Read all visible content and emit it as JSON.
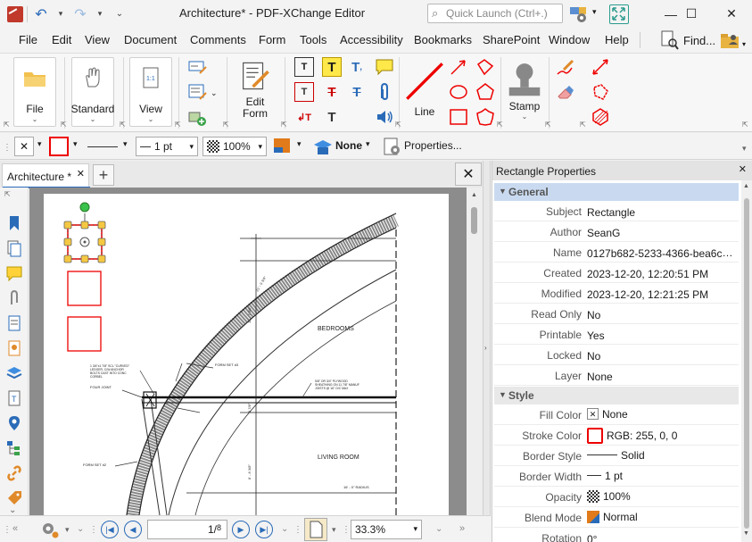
{
  "window": {
    "title": "Architecture* - PDF-XChange Editor",
    "quick_launch_placeholder": "Quick Launch (Ctrl+.)",
    "minimize": "—",
    "maximize": "☐",
    "close": "✕"
  },
  "menu": {
    "items": [
      "File",
      "Edit",
      "View",
      "Document",
      "Comments",
      "Form",
      "Tools",
      "Accessibility",
      "Bookmarks",
      "SharePoint",
      "Window",
      "Help"
    ],
    "find_label": "Find..."
  },
  "ribbon": {
    "file_label": "File",
    "standard_label": "Standard",
    "view_label": "View",
    "edit_form_label_1": "Edit",
    "edit_form_label_2": "Form",
    "line_label": "Line",
    "stamp_label": "Stamp"
  },
  "toolbar": {
    "line_width": "1 pt",
    "opacity": "100%",
    "none_label": "None",
    "properties_label": "Properties..."
  },
  "doc": {
    "tab_label": "Architecture *",
    "drawing_labels": {
      "bedrooms": "BEDROOMS",
      "living_room": "LIVING ROOM",
      "form_set_a": "FORM SET #3",
      "form_set_b": "FORM SET #2",
      "four_joint": "FOUR JOINT",
      "note_left": "1 3/4\"x1 7/8\" SCL \"CURVED\" LEDGER, C/W ANCHOR BOLTS CAST INTO CONC CORBEL",
      "note_right": "5/8\" OR 3/4\" PLYWOOD SHEATHING ON 11 7/8\" MANUF JOISTS @ 16\" O/C MAX",
      "radius": "16' - 0\" RADIUS"
    }
  },
  "status": {
    "page_current": "1",
    "page_total": "8",
    "zoom": "33.3%"
  },
  "pane": {
    "title": "Rectangle Properties",
    "sections": {
      "general": "General",
      "style": "Style"
    },
    "general_rows": [
      {
        "key": "Subject",
        "value": "Rectangle"
      },
      {
        "key": "Author",
        "value": "SeanG"
      },
      {
        "key": "Name",
        "value": "0127b682-5233-4366-bea6c1dc..."
      },
      {
        "key": "Created",
        "value": "2023-12-20, 12:20:51 PM"
      },
      {
        "key": "Modified",
        "value": "2023-12-20, 12:21:25 PM"
      },
      {
        "key": "Read Only",
        "value": "No"
      },
      {
        "key": "Printable",
        "value": "Yes"
      },
      {
        "key": "Locked",
        "value": "No"
      },
      {
        "key": "Layer",
        "value": "None"
      }
    ],
    "style_rows": [
      {
        "key": "Fill Color",
        "value": "None"
      },
      {
        "key": "Stroke Color",
        "value": "RGB: 255, 0, 0"
      },
      {
        "key": "Border Style",
        "value": "Solid"
      },
      {
        "key": "Border Width",
        "value": "1 pt"
      },
      {
        "key": "Opacity",
        "value": "100%"
      },
      {
        "key": "Blend Mode",
        "value": "Normal"
      },
      {
        "key": "Rotation",
        "value": "0°"
      }
    ]
  },
  "colors": {
    "accent": "#2a6bb8",
    "stroke_red": "#ff0000",
    "section_bg": "#e8e8e8",
    "selected_section": "#d9e6f5"
  }
}
